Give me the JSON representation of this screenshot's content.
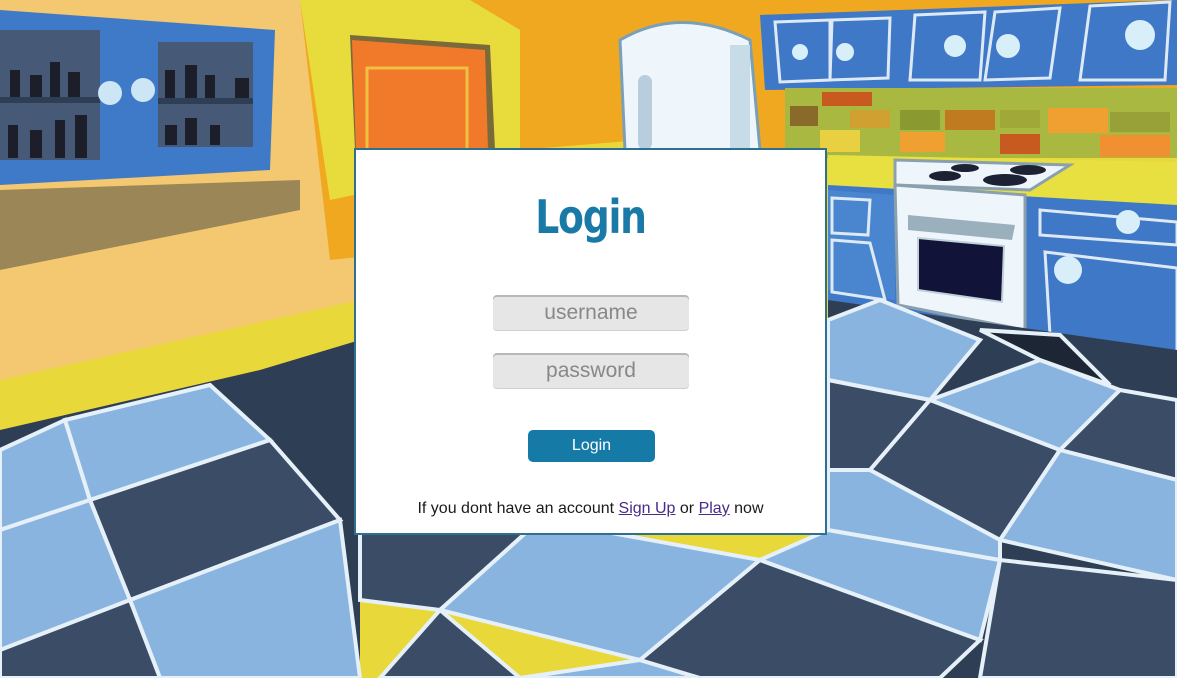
{
  "login": {
    "title": "Login",
    "username_placeholder": "username",
    "password_placeholder": "password",
    "button_label": "Login",
    "footer_prefix": "If you dont have an account",
    "signup_link": "Sign Up",
    "or_text": "or",
    "play_link": "Play",
    "footer_suffix": "now"
  },
  "colors": {
    "accent": "#1a7aa7",
    "button": "#157ba6",
    "link": "#4a2a86"
  }
}
